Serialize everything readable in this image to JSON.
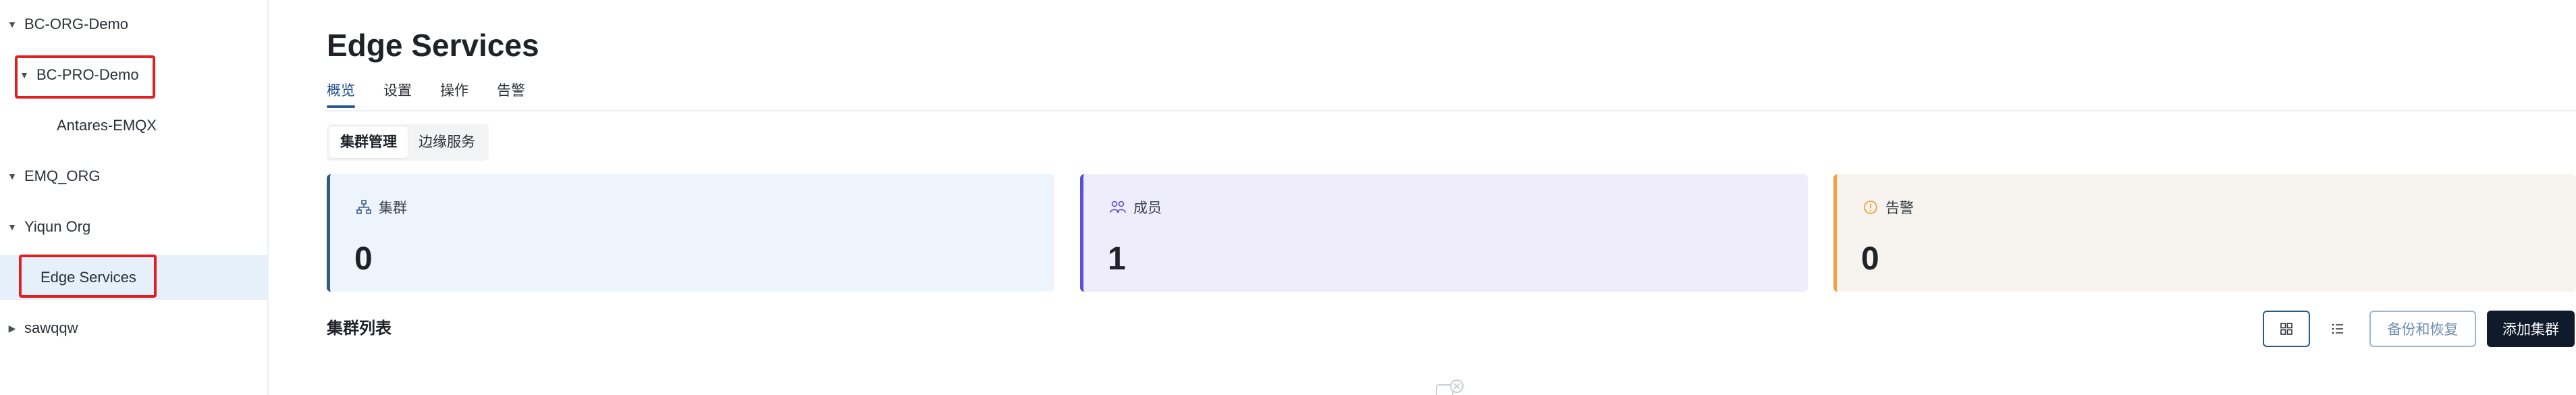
{
  "sidebar": {
    "items": [
      {
        "label": "BC-ORG-Demo",
        "expanded": true,
        "level": 0
      },
      {
        "label": "BC-PRO-Demo",
        "expanded": true,
        "level": 1
      },
      {
        "label": "Antares-EMQX",
        "level": 2
      },
      {
        "label": "EMQ_ORG",
        "expanded": true,
        "level": 0
      },
      {
        "label": "Yiqun Org",
        "expanded": true,
        "level": 0
      },
      {
        "label": "Edge Services",
        "level": 1,
        "selected": true
      },
      {
        "label": "sawqqw",
        "expanded": false,
        "level": 0
      }
    ]
  },
  "page": {
    "title": "Edge Services",
    "tabs": [
      "概览",
      "设置",
      "操作",
      "告警"
    ],
    "active_tab": "概览"
  },
  "segment_tabs": [
    "集群管理",
    "边缘服务"
  ],
  "stats": [
    {
      "label": "集群",
      "value": "0",
      "icon": "cluster-icon"
    },
    {
      "label": "成员",
      "value": "1",
      "icon": "members-icon"
    },
    {
      "label": "告警",
      "value": "0",
      "icon": "alert-icon"
    }
  ],
  "cluster_list": {
    "title": "集群列表",
    "backup_label": "备份和恢复",
    "add_label": "添加集群"
  },
  "colors": {
    "accent": "#2d5a8c",
    "highlight_box": "#e02020",
    "selected_bg": "#e6f0fb",
    "add_button_bg": "#0f1a2a"
  }
}
